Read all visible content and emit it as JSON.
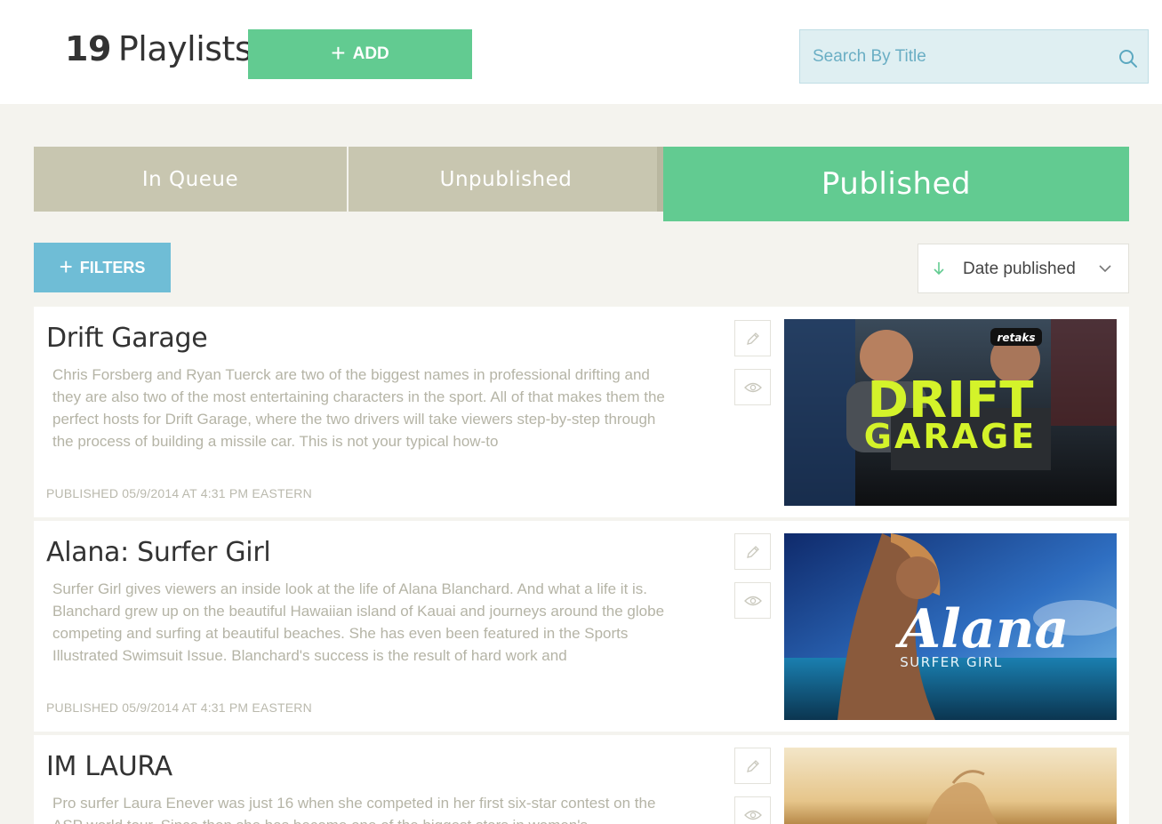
{
  "header": {
    "count": "19",
    "count_word": "Playlists",
    "add_label": "ADD",
    "search_placeholder": "Search By Title"
  },
  "tabs": [
    {
      "label": "In Queue",
      "active": false
    },
    {
      "label": "Unpublished",
      "active": false
    },
    {
      "label": "Published",
      "active": true
    }
  ],
  "toolbar": {
    "filters_label": "FILTERS",
    "sort_label": "Date published"
  },
  "playlists": [
    {
      "title": "Drift Garage",
      "description": "Chris Forsberg and Ryan Tuerck are two of the biggest names in professional drifting and they are also two of the most entertaining characters in the sport. All of that makes them the perfect hosts for Drift Garage, where the two drivers will take viewers step-by-step through the process of building a missile car. This is not your typical how-to",
      "published": "PUBLISHED 05/9/2014 AT 4:31 PM EASTERN",
      "thumb_line1": "DRIFT",
      "thumb_line2": "GARAGE",
      "thumb_cap": "retaks"
    },
    {
      "title": "Alana: Surfer Girl",
      "description": "Surfer Girl gives viewers an inside look at the life of Alana Blanchard. And what a life it is. Blanchard grew up on the beautiful Hawaiian island of Kauai and journeys around the globe competing and surfing at beautiful beaches. She has even been featured in the Sports Illustrated Swimsuit Issue. Blanchard's success is the result of hard work and",
      "published": "PUBLISHED 05/9/2014 AT 4:31 PM EASTERN",
      "thumb_line1": "Alana",
      "thumb_line2": "SURFER GIRL"
    },
    {
      "title": "IM LAURA",
      "description": "Pro surfer Laura Enever was just 16 when she competed in her first six-star contest on the ASP world tour. Since then she has become one of the biggest stars in women's",
      "published": ""
    }
  ],
  "colors": {
    "accent_green": "#62cb91",
    "tab_inactive": "#c8c6b0",
    "filters_blue": "#6fbdd6",
    "search_bg": "#dfeff2"
  },
  "icons": [
    "plus-icon",
    "search-icon",
    "arrow-down-icon",
    "chevron-down-icon",
    "pencil-icon",
    "eye-icon"
  ]
}
